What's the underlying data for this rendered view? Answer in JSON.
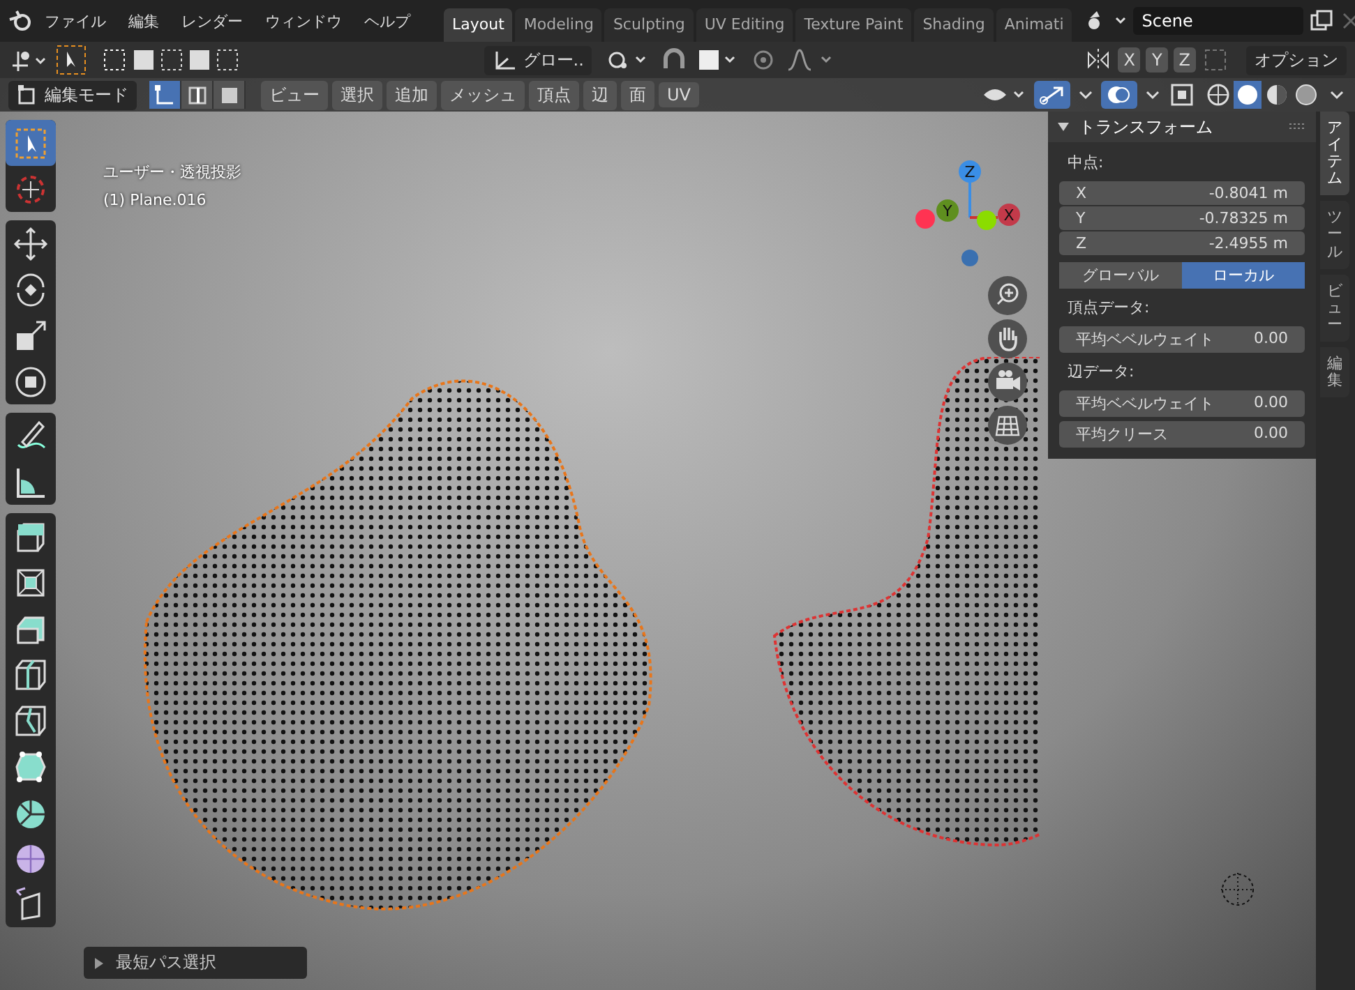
{
  "menu": [
    "ファイル",
    "編集",
    "レンダー",
    "ウィンドウ",
    "ヘルプ"
  ],
  "workspace_tabs": [
    {
      "label": "Layout",
      "selected": true
    },
    {
      "label": "Modeling",
      "selected": false
    },
    {
      "label": "Sculpting",
      "selected": false
    },
    {
      "label": "UV Editing",
      "selected": false
    },
    {
      "label": "Texture Paint",
      "selected": false
    },
    {
      "label": "Shading",
      "selected": false
    },
    {
      "label": "Animati",
      "selected": false
    }
  ],
  "scene": {
    "name": "Scene"
  },
  "tool_header": {
    "orientation": "グロー..",
    "axes": [
      "X",
      "Y",
      "Z"
    ],
    "options": "オプション"
  },
  "header": {
    "mode": "編集モード",
    "select_modes": [
      {
        "kind": "vertex",
        "selected": true
      },
      {
        "kind": "edge",
        "selected": false
      },
      {
        "kind": "face",
        "selected": false
      }
    ],
    "menus": [
      "ビュー",
      "選択",
      "追加",
      "メッシュ",
      "頂点",
      "辺",
      "面",
      "UV"
    ]
  },
  "viewport": {
    "view_name": "ユーザー・透視投影",
    "object_name": "(1) Plane.016",
    "gizmo_axes": [
      "Z",
      "Y",
      "X"
    ]
  },
  "toolbar": [
    [
      {
        "kind": "select",
        "selected": true
      },
      {
        "kind": "cursor",
        "selected": false
      }
    ],
    [
      {
        "kind": "move",
        "selected": false
      },
      {
        "kind": "rotate",
        "selected": false
      },
      {
        "kind": "scale",
        "selected": false
      },
      {
        "kind": "transform",
        "selected": false
      }
    ],
    [
      {
        "kind": "annotate",
        "selected": false
      },
      {
        "kind": "measure",
        "selected": false
      }
    ],
    [
      {
        "kind": "extrude",
        "selected": false
      },
      {
        "kind": "inset",
        "selected": false
      },
      {
        "kind": "bevel",
        "selected": false
      },
      {
        "kind": "loopcut",
        "selected": false
      },
      {
        "kind": "knife",
        "selected": false
      },
      {
        "kind": "polybuild",
        "selected": false
      },
      {
        "kind": "spin",
        "selected": false
      },
      {
        "kind": "smooth",
        "selected": false
      },
      {
        "kind": "shear",
        "selected": false
      }
    ]
  ],
  "sidebar": {
    "title": "トランスフォーム",
    "median_label": "中点:",
    "fields": [
      {
        "label": "X",
        "value": "-0.8041 m"
      },
      {
        "label": "Y",
        "value": "-0.78325 m"
      },
      {
        "label": "Z",
        "value": "-2.4955 m"
      }
    ],
    "space": [
      {
        "label": "グローバル",
        "selected": false
      },
      {
        "label": "ローカル",
        "selected": true
      }
    ],
    "sections": [
      {
        "label": "頂点データ:",
        "rows": [
          {
            "label": "平均ベベルウェイト",
            "value": "0.00"
          }
        ]
      },
      {
        "label": "辺データ:",
        "rows": [
          {
            "label": "平均ベベルウェイト",
            "value": "0.00"
          },
          {
            "label": "平均クリース",
            "value": "0.00"
          }
        ]
      }
    ]
  },
  "sidebar_tabs": [
    {
      "label": "アイテム",
      "selected": true
    },
    {
      "label": "ツール",
      "selected": false
    },
    {
      "label": "ビュー",
      "selected": false
    },
    {
      "label": "編集",
      "selected": false
    }
  ],
  "last_operator": "最短パス選択"
}
